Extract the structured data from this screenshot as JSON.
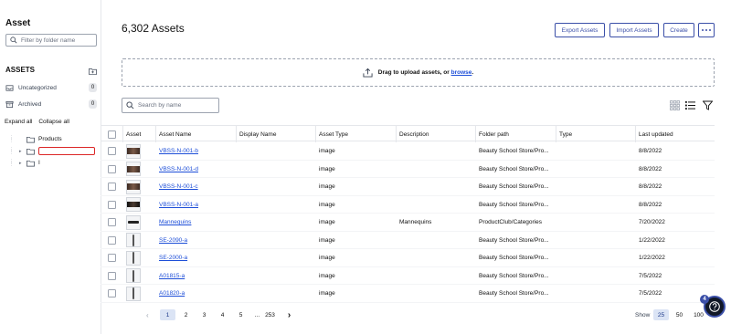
{
  "sidebar": {
    "title": "Asset",
    "filter_placeholder": "Filter by folder name",
    "assets_heading": "ASSETS",
    "items": [
      {
        "label": "Uncategorized",
        "count": "0"
      },
      {
        "label": "Archived",
        "count": "0"
      }
    ],
    "expand_all": "Expand all",
    "collapse_all": "Collapse all",
    "tree": [
      {
        "label": "Products"
      },
      {
        "label": ""
      },
      {
        "label": "I"
      }
    ]
  },
  "main": {
    "title": "6,302 Assets",
    "buttons": {
      "export": "Export Assets",
      "import": "Import Assets",
      "create": "Create"
    },
    "dropzone": {
      "text": "Drag to upload assets, or",
      "link": "browse",
      "suffix": "."
    },
    "search_placeholder": "Search by name"
  },
  "table": {
    "columns": [
      "Asset",
      "Asset Name",
      "Display Name",
      "Asset Type",
      "Description",
      "Folder path",
      "Type",
      "Last updated"
    ],
    "rows": [
      {
        "thumb": "dark",
        "name": "VBSS-N-001-b",
        "display": "",
        "type": "image",
        "description": "",
        "folder": "Beauty School Store/Pro...",
        "kind": "",
        "updated": "8/8/2022"
      },
      {
        "thumb": "dark",
        "name": "VBSS-N-001-d",
        "display": "",
        "type": "image",
        "description": "",
        "folder": "Beauty School Store/Pro...",
        "kind": "",
        "updated": "8/8/2022"
      },
      {
        "thumb": "dark",
        "name": "VBSS-N-001-c",
        "display": "",
        "type": "image",
        "description": "",
        "folder": "Beauty School Store/Pro...",
        "kind": "",
        "updated": "8/8/2022"
      },
      {
        "thumb": "vdark",
        "name": "VBSS-N-001-a",
        "display": "",
        "type": "image",
        "description": "",
        "folder": "Beauty School Store/Pro...",
        "kind": "",
        "updated": "8/8/2022"
      },
      {
        "thumb": "mini",
        "name": "Mannequins",
        "display": "",
        "type": "image",
        "description": "Mannequins",
        "folder": "ProductClub/Categories",
        "kind": "",
        "updated": "7/20/2022"
      },
      {
        "thumb": "tool",
        "name": "SE-2090-a",
        "display": "",
        "type": "image",
        "description": "",
        "folder": "Beauty School Store/Pro...",
        "kind": "",
        "updated": "1/22/2022"
      },
      {
        "thumb": "tool",
        "name": "SE-2000-a",
        "display": "",
        "type": "image",
        "description": "",
        "folder": "Beauty School Store/Pro...",
        "kind": "",
        "updated": "1/22/2022"
      },
      {
        "thumb": "tool",
        "name": "A01815-a",
        "display": "",
        "type": "image",
        "description": "",
        "folder": "Beauty School Store/Pro...",
        "kind": "",
        "updated": "7/5/2022"
      },
      {
        "thumb": "tool",
        "name": "A01820-a",
        "display": "",
        "type": "image",
        "description": "",
        "folder": "Beauty School Store/Pro...",
        "kind": "",
        "updated": "7/5/2022"
      }
    ]
  },
  "pagination": {
    "pages": [
      "1",
      "2",
      "3",
      "4",
      "5"
    ],
    "ellipsis": "...",
    "last": "253",
    "current": "1",
    "show_label": "Show",
    "sizes": [
      "25",
      "50",
      "100"
    ],
    "current_size": "25"
  },
  "help": {
    "badge": "4"
  },
  "colors": {
    "accent": "#3b4fa8",
    "link": "#1d4ed8"
  }
}
